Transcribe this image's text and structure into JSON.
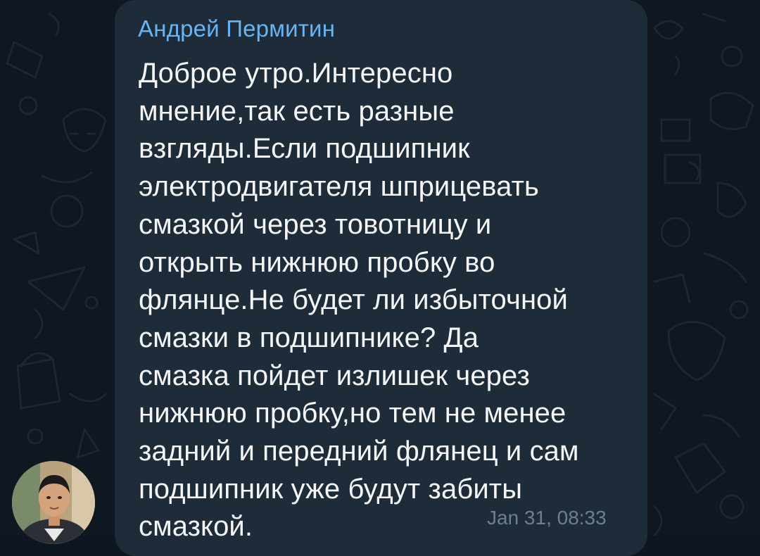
{
  "chat": {
    "background_color": "#0f1720",
    "doodle_color": "#1b2530"
  },
  "message": {
    "sender": "Андрей Пермитин",
    "sender_color": "#6ab3f3",
    "bubble_color": "#1e2c3a",
    "text": "Доброе утро.Интересно\nмнение,так есть разные\nвзгляды.Если подшипник\nэлектродвигателя шприцевать\nсмазкой через товотницу и\nоткрыть нижнюю пробку во\nфлянце.Не будет ли избыточной\nсмазки в подшипнике? Да\nсмазка пойдет излишек через\nнижнюю пробку,но тем не менее\nзадний и передний флянец и сам\nподшипник уже будут забиты\nсмазкой.",
    "timestamp": "Jan 31, 08:33"
  },
  "avatar": {
    "icon": "user-photo"
  }
}
